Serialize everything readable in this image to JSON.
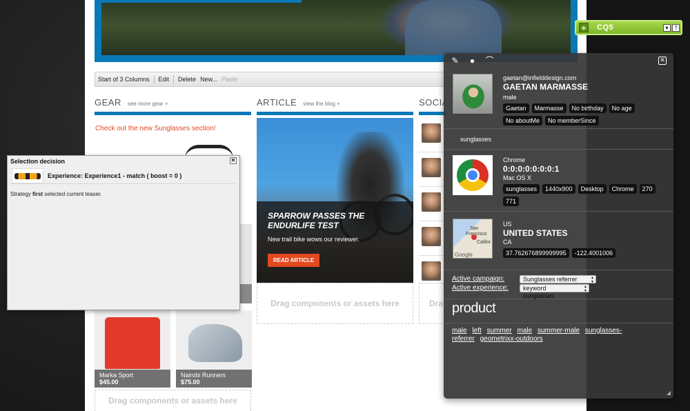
{
  "editbar": {
    "start_columns": "Start of 3 Columns",
    "edit": "Edit",
    "delete": "Delete",
    "new": "New...",
    "paste": "Paste"
  },
  "columns": {
    "gear": {
      "title": "GEAR",
      "sub": "see more gear +"
    },
    "article": {
      "title": "ARTICLE",
      "sub": "view the blog +"
    },
    "social": {
      "title": "SOCIA"
    }
  },
  "gear_link": "Check out the new Sunglasses section!",
  "teaser": {
    "title_line1": "SPARROW PASSES THE",
    "title_line2": "ENDURLIFE TEST",
    "subtitle": "New trail bike wows our reviewer.",
    "button": "READ ARTICLE"
  },
  "dropzone_text": "Drag components or assets here",
  "dropzone_partial": "Dra",
  "products": [
    {
      "name": "Marka Sport",
      "price": "$45.00"
    },
    {
      "name": "Nairobi Runners",
      "price": "$75.00"
    }
  ],
  "selection_decision": {
    "title": "Selection decision",
    "experience": "Experience: Experience1 - match ( boost = 0 )",
    "strategy_prefix": "Strategy ",
    "strategy_name": "first",
    "strategy_suffix": " selected current teaser."
  },
  "cq5": {
    "label": "CQ5",
    "dropdown": "▾",
    "help": "?"
  },
  "clientcontext": {
    "profile": {
      "email": "gaetan@infielddesign.com",
      "name": "GAETAN MARMASSE",
      "gender": "male",
      "pills": [
        "Gaetan",
        "Marmasse",
        "No birthday",
        "No age",
        "No aboutMe",
        "No memberSince"
      ]
    },
    "segment": "sunglasses",
    "browser": {
      "name": "Chrome",
      "ip": "0:0:0:0:0:0:0:1",
      "os": "Mac OS X",
      "pills": [
        "sunglasses",
        "1440x900",
        "Desktop",
        "Chrome",
        "270",
        "771"
      ]
    },
    "geo": {
      "country_code": "US",
      "country": "UNITED STATES",
      "region": "CA",
      "lat": "37.762676899999995",
      "lng": "-122.4001006",
      "map_labels": [
        "San",
        "Francisco",
        "Califor",
        "Google"
      ]
    },
    "campaign": {
      "campaign_label": "Active campaign:",
      "campaign_value": "Sunglasses referrer",
      "experience_label": "Active experience:",
      "experience_value": "keyword sunglasses"
    },
    "product_heading": "product",
    "tags": [
      "male",
      "left",
      "summer",
      "male",
      "summer-male",
      "sunglasses-",
      "referrer",
      "geometrixx-outdoors"
    ]
  },
  "colors": {
    "brand_blue": "#0a79b8",
    "accent_orange": "#e4481f",
    "cq5_green": "#8cc63f"
  }
}
